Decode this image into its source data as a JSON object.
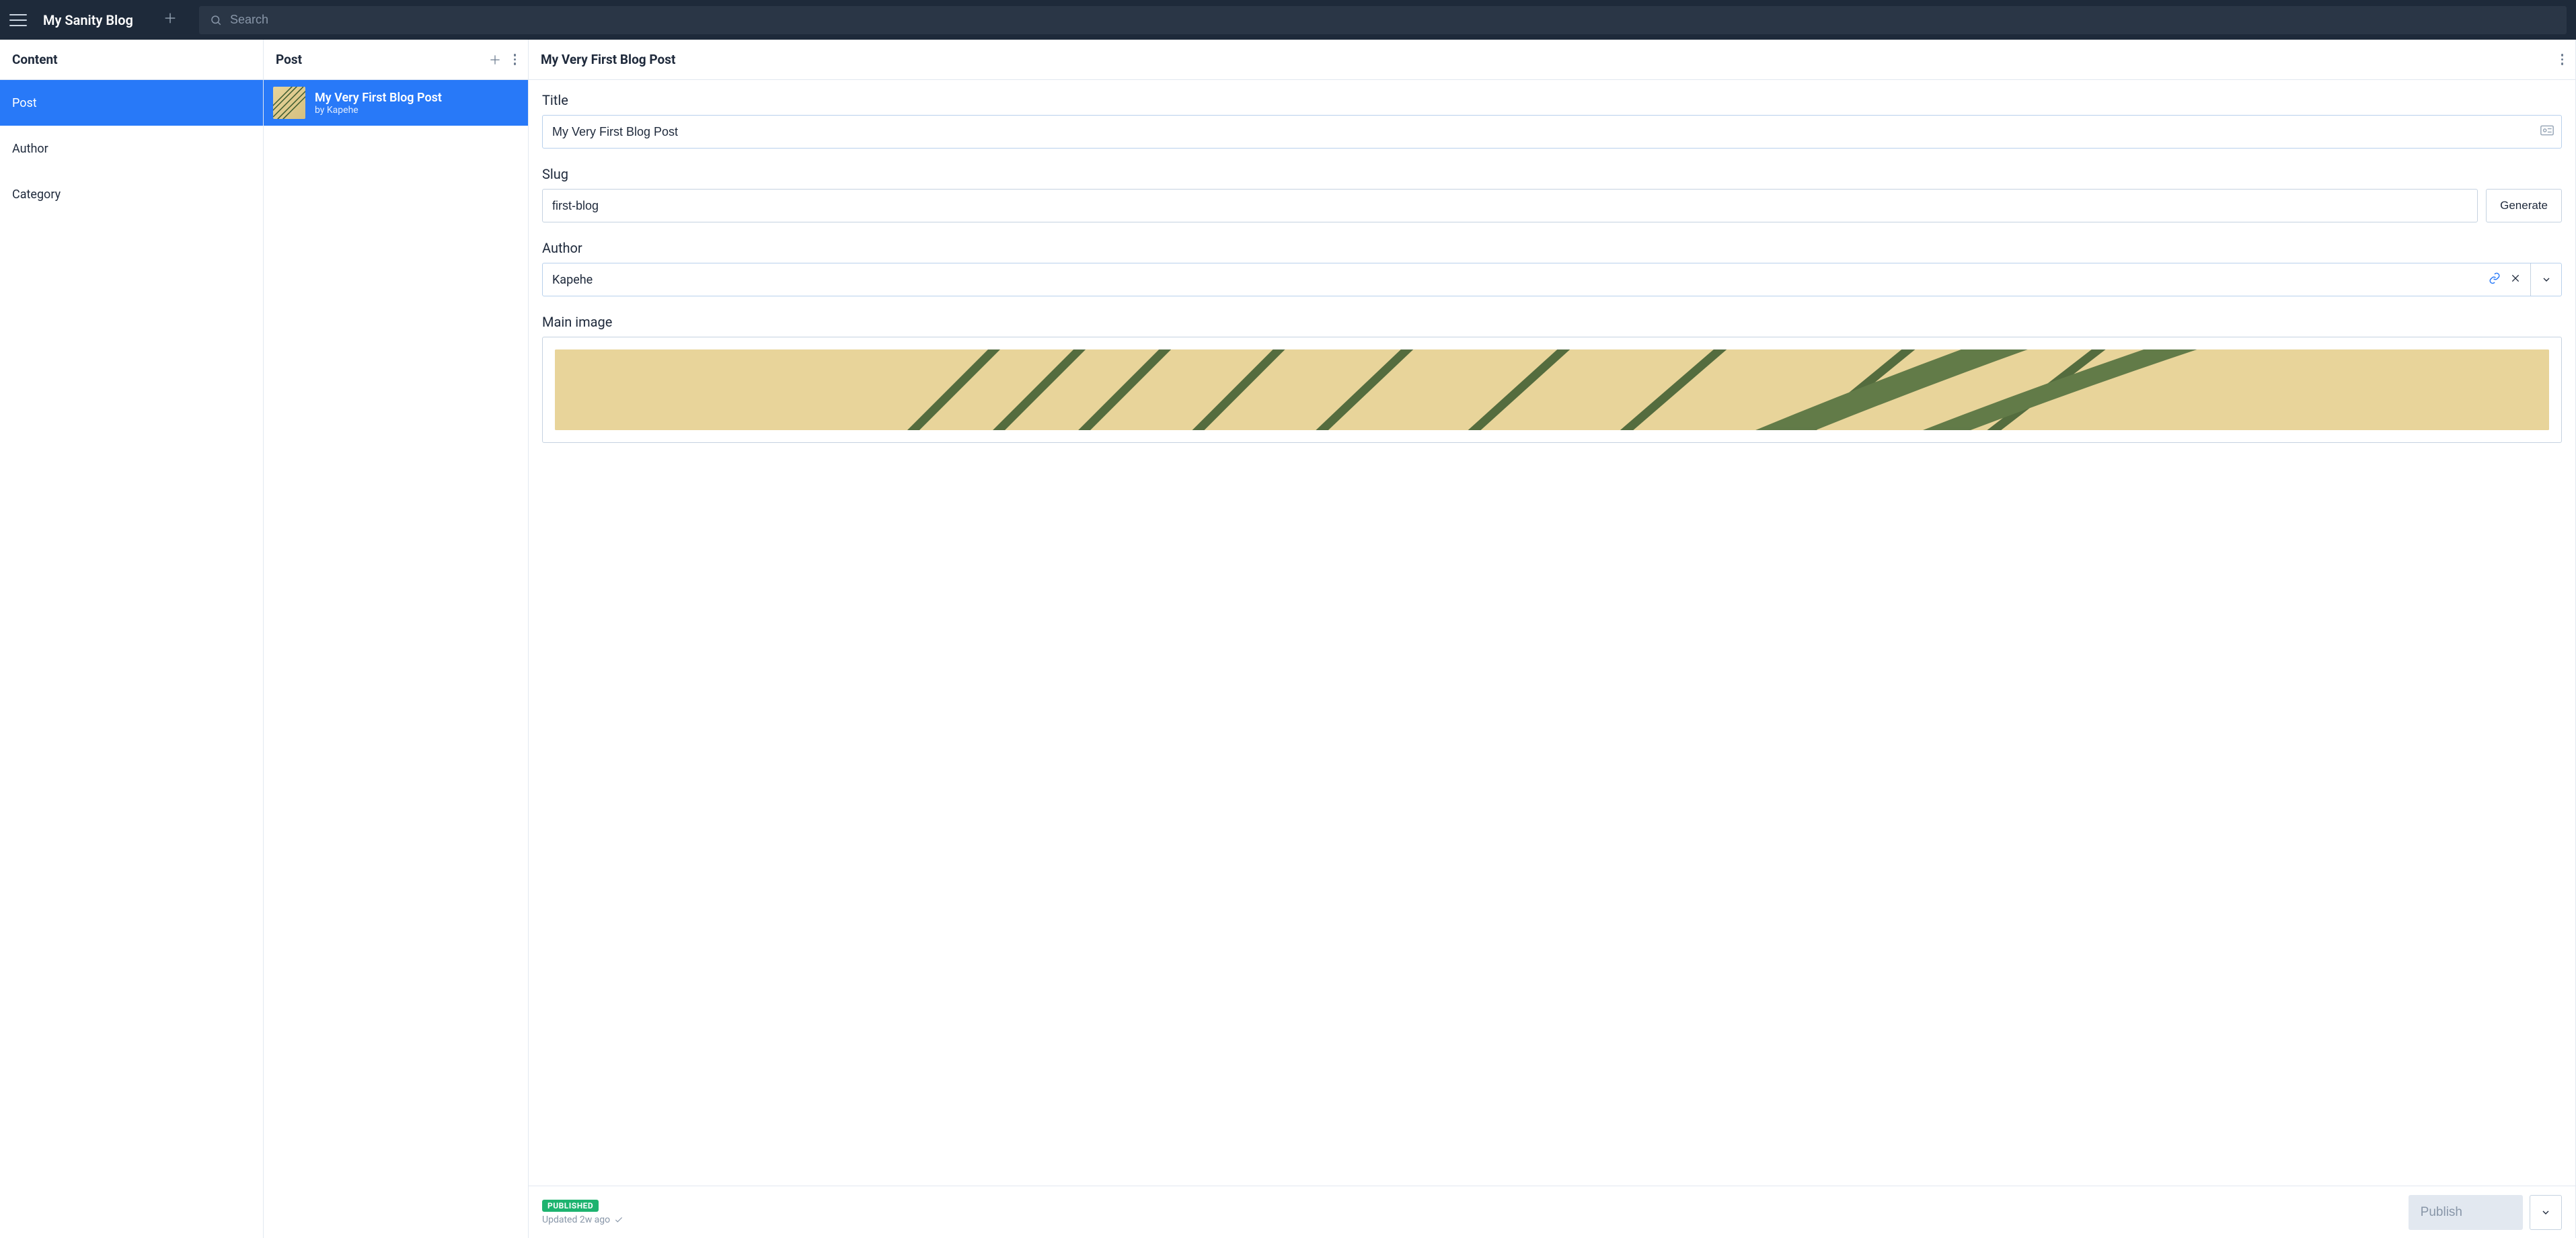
{
  "app": {
    "title": "My Sanity Blog",
    "search_placeholder": "Search"
  },
  "columns": {
    "content": {
      "title": "Content",
      "items": [
        {
          "label": "Post",
          "active": true
        },
        {
          "label": "Author",
          "active": false
        },
        {
          "label": "Category",
          "active": false
        }
      ]
    },
    "post": {
      "title": "Post",
      "items": [
        {
          "title": "My Very First Blog Post",
          "subtitle": "by Kapehe",
          "active": true
        }
      ]
    }
  },
  "editor": {
    "doc_title": "My Very First Blog Post",
    "fields": {
      "title": {
        "label": "Title",
        "value": "My Very First Blog Post"
      },
      "slug": {
        "label": "Slug",
        "value": "first-blog",
        "generate": "Generate"
      },
      "author": {
        "label": "Author",
        "value": "Kapehe"
      },
      "main_image": {
        "label": "Main image"
      }
    },
    "status": {
      "badge": "PUBLISHED",
      "updated": "Updated 2w ago"
    },
    "actions": {
      "publish": "Publish"
    }
  }
}
